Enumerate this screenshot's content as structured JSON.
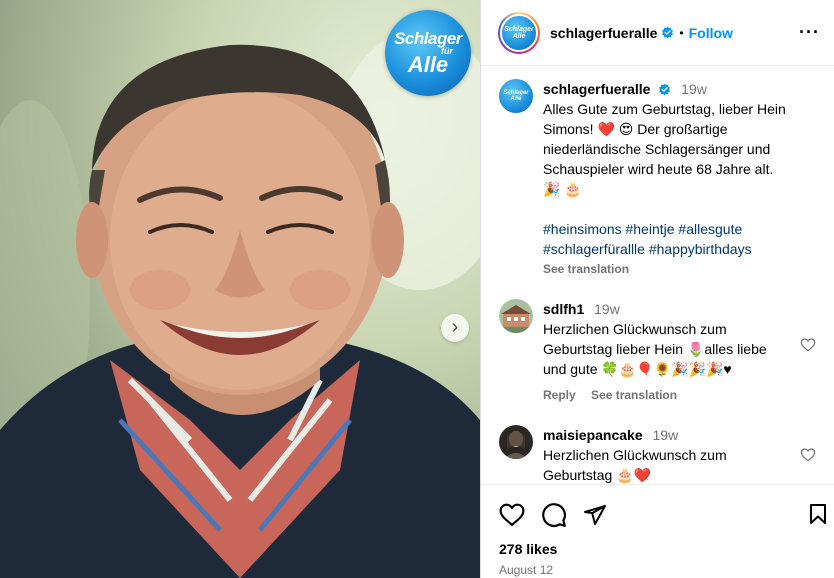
{
  "post": {
    "logo": {
      "line1": "Schlager",
      "line2": "für",
      "line3": "Alle"
    },
    "next_arrow": "›"
  },
  "header": {
    "username": "schlagerfueralle",
    "separator": "•",
    "follow_label": "Follow",
    "more_label": "···",
    "avatar_text": "Schlager Alle"
  },
  "caption": {
    "username": "schlagerfueralle",
    "time": "19w",
    "text": "Alles Gute zum Geburtstag, lieber Hein Simons! ❤️ 😍 Der großartige niederländische Schlagersänger und Schauspieler wird heute 68 Jahre alt. 🎉 🎂",
    "hashtags": "#heinsimons #heintje #allesgute #schlagerfürallle #happybirthdays",
    "see_translation": "See translation"
  },
  "comments": [
    {
      "username": "sdlfh1",
      "time": "19w",
      "text": "Herzlichen Glückwunsch zum Geburtstag lieber Hein 🌷alles liebe und gute 🍀🎂🎈🌻🎉🎉🎉♥",
      "reply_label": "Reply",
      "see_translation": "See translation"
    },
    {
      "username": "maisiepancake",
      "time": "19w",
      "text": "Herzlichen Glückwunsch zum Geburtstag 🎂❤️"
    }
  ],
  "footer": {
    "likes": "278 likes",
    "date": "August 12"
  },
  "colors": {
    "accent": "#0095f6",
    "hashtag": "#00376b",
    "muted": "#737373"
  }
}
